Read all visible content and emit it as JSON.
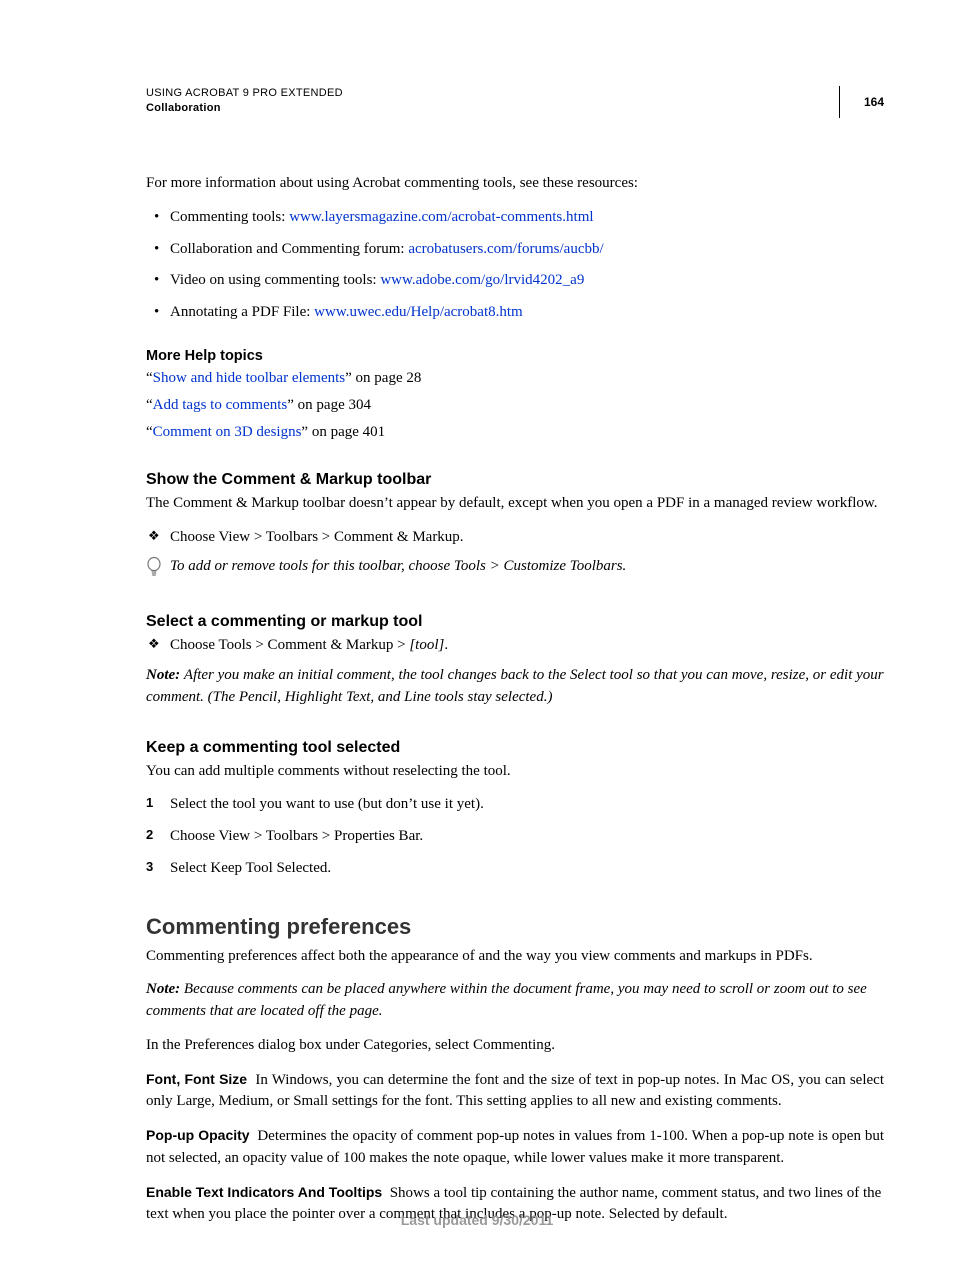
{
  "header": {
    "title": "USING ACROBAT 9 PRO EXTENDED",
    "section": "Collaboration",
    "page": "164"
  },
  "intro": "For more information about using Acrobat commenting tools, see these resources:",
  "resources": [
    {
      "label": "Commenting tools: ",
      "link": "www.layersmagazine.com/acrobat-comments.html"
    },
    {
      "label": "Collaboration and Commenting forum: ",
      "link": "acrobatusers.com/forums/aucbb/"
    },
    {
      "label": "Video on using commenting tools: ",
      "link": "www.adobe.com/go/lrvid4202_a9"
    },
    {
      "label": "Annotating a PDF File: ",
      "link": "www.uwec.edu/Help/acrobat8.htm"
    }
  ],
  "moreHelp": {
    "heading": "More Help topics",
    "items": [
      {
        "link": "Show and hide toolbar elements",
        "suffix": "” on page 28"
      },
      {
        "link": "Add tags to comments",
        "suffix": "” on page 304"
      },
      {
        "link": "Comment on 3D designs",
        "suffix": "” on page 401"
      }
    ]
  },
  "showToolbar": {
    "heading": "Show the Comment & Markup toolbar",
    "body": "The Comment & Markup toolbar doesn’t appear by default, except when you open a PDF in a managed review workflow.",
    "step": "Choose View > Toolbars > Comment & Markup.",
    "tip": "To add or remove tools for this toolbar, choose Tools > Customize Toolbars."
  },
  "selectTool": {
    "heading": "Select a commenting or markup tool",
    "stepPrefix": "Choose Tools > Comment & Markup > ",
    "stepItalic": "[tool]",
    "stepSuffix": ".",
    "noteLabel": "Note: ",
    "note": "After you make an initial comment, the tool changes back to the Select tool so that you can move, resize, or edit your comment. (The Pencil, Highlight Text, and Line tools stay selected.)"
  },
  "keepTool": {
    "heading": "Keep a commenting tool selected",
    "body": "You can add multiple comments without reselecting the tool.",
    "steps": [
      "Select the tool you want to use (but don’t use it yet).",
      "Choose View > Toolbars > Properties Bar.",
      "Select Keep Tool Selected."
    ]
  },
  "prefs": {
    "heading": "Commenting preferences",
    "p1": "Commenting preferences affect both the appearance of and the way you view comments and markups in PDFs.",
    "noteLabel": "Note: ",
    "note": "Because comments can be placed anywhere within the document frame, you may need to scroll or zoom out to see comments that are located off the page.",
    "p2": "In the Preferences dialog box under Categories, select Commenting.",
    "items": [
      {
        "term": "Font, Font Size",
        "desc": "In Windows, you can determine the font and the size of text in pop-up notes. In Mac OS, you can select only Large, Medium, or Small settings for the font. This setting applies to all new and existing comments."
      },
      {
        "term": "Pop-up Opacity",
        "desc": "Determines the opacity of comment pop-up notes in values from 1-100. When a pop-up note is open but not selected, an opacity value of 100 makes the note opaque, while lower values make it more transparent."
      },
      {
        "term": "Enable Text Indicators And Tooltips",
        "desc": "Shows a tool tip containing the author name, comment status, and two lines of the text when you place the pointer over a comment that includes a pop-up note. Selected by default."
      }
    ]
  },
  "footer": "Last updated 9/30/2011"
}
